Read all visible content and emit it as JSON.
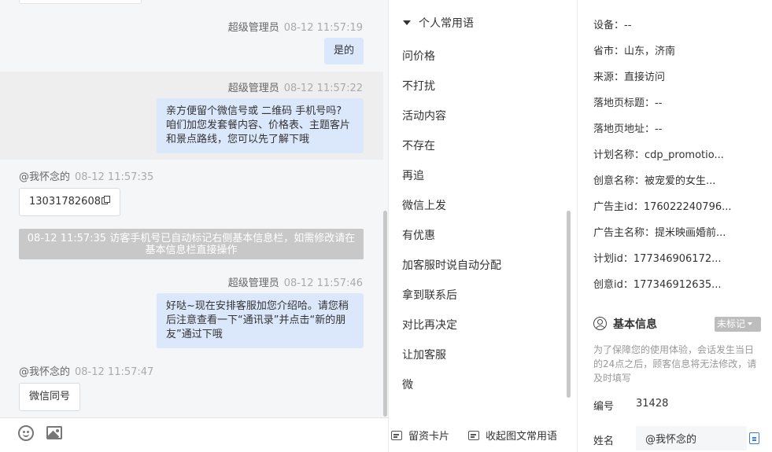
{
  "chat": {
    "messages": [
      {
        "sender": "超级管理员",
        "time": "08-12 11:57:19",
        "text": "是的"
      },
      {
        "sender": "超级管理员",
        "time": "08-12 11:57:22",
        "lines": [
          "亲方便留个微信号或 二维码 手机号吗?",
          "咱们加您发套餐内容、价格表、主题客片",
          "和景点路线，您可以先了解下哦"
        ]
      },
      {
        "sender": "@我怀念的",
        "time": "08-12 11:57:35",
        "text": "13031782608"
      },
      {
        "system": "08-12 11:57:35 访客手机号已自动标记右侧基本信息栏，如需修改请在基本信息栏直接操作"
      },
      {
        "sender": "超级管理员",
        "time": "08-12 11:57:46",
        "lines": [
          "好哒~现在安排客服加您介绍哈。请您稍",
          "后注意查看一下“通讯录”并点击“新的朋",
          "友”通过下哦"
        ]
      },
      {
        "sender": "@我怀念的",
        "time": "08-12 11:57:47",
        "text": "微信同号"
      }
    ],
    "toolbar": {
      "emoji_icon": "emoji-icon",
      "image_icon": "image-icon"
    }
  },
  "phrases": {
    "header": "个人常用语",
    "items": [
      "问价格",
      "不打扰",
      "活动内容",
      "不存在",
      "再追",
      "微信上发",
      "有优惠",
      "加客服时说自动分配",
      "拿到联系后",
      "对比再决定",
      "让加客服",
      "微"
    ],
    "footer": {
      "card_label": "留资卡片",
      "collapse_label": "收起图文常用语"
    }
  },
  "info": {
    "fields": [
      "设备：--",
      "省市：山东，济南",
      "来源：直接访问",
      "落地页标题：--",
      "落地页地址：--",
      "计划名称：cdp_promotio...",
      "创意名称：被宠爱的女生...",
      "广告主id：176022240796...",
      "广告主名称：提米映画婚前...",
      "计划id：177346906172...",
      "创意id：177346912635..."
    ],
    "basic": {
      "title": "基本信息",
      "tag": "未标记",
      "notice": "为了保障您的使用体验，会话发生当日的24点之后，顾客信息将无法修改，请及时填写",
      "id_label": "编号",
      "id_value": "31428",
      "name_label": "姓名",
      "name_value": "@我怀念的"
    }
  }
}
